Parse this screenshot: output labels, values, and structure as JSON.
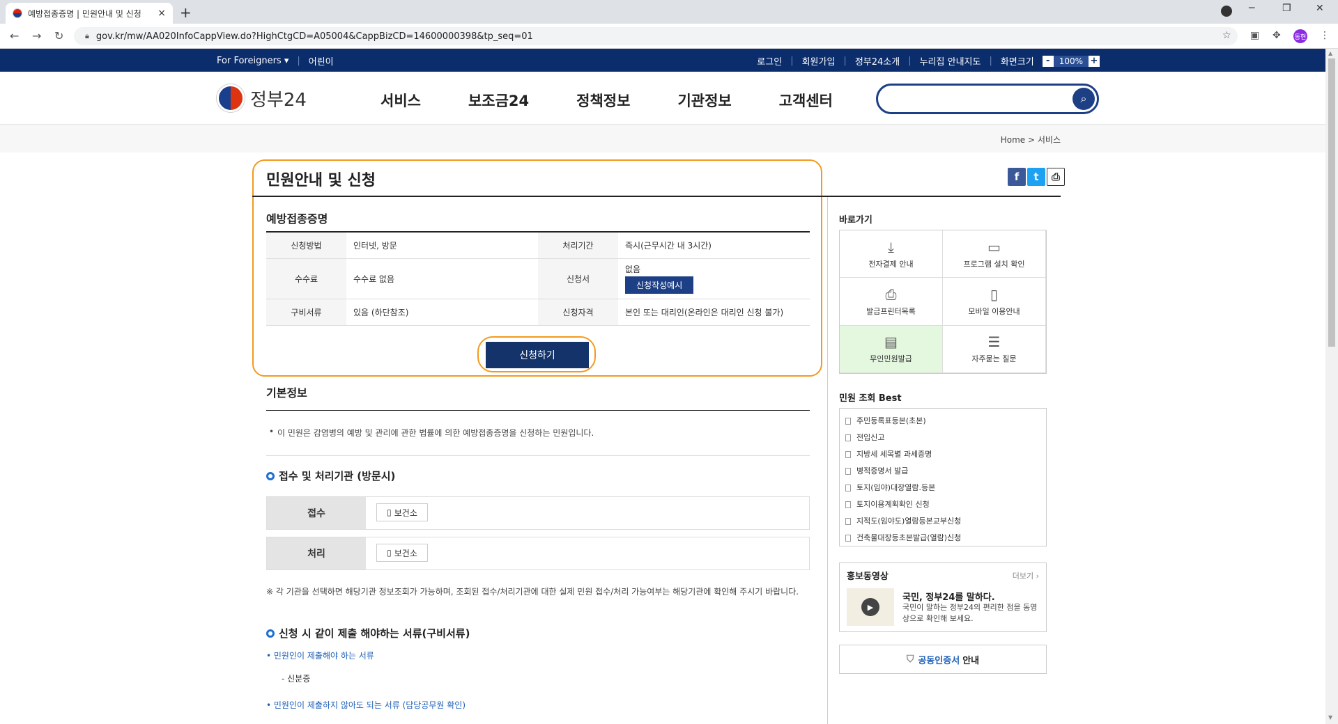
{
  "browser": {
    "tab_title": "예방접종증명 | 민원안내 및 신청",
    "tab_close": "×",
    "new_tab": "+",
    "url": "gov.kr/mw/AA020InfoCappView.do?HighCtgCD=A05004&CappBizCD=14600000398&tp_seq=01",
    "profile_initial": "동현"
  },
  "util": {
    "foreigners": "For Foreigners ▾",
    "kids": "어린이",
    "login": "로그인",
    "signup": "회원가입",
    "intro": "정부24소개",
    "sitemap": "누리집 안내지도",
    "screen_size": "화면크기",
    "zoom_minus": "-",
    "zoom_value": "100%",
    "zoom_plus": "+"
  },
  "header": {
    "logo_text": "정부24",
    "nav": [
      "서비스",
      "보조금24",
      "정책정보",
      "기관정보",
      "고객센터"
    ],
    "search_placeholder": ""
  },
  "breadcrumb": {
    "home": "Home",
    "sep": ">",
    "current": "서비스"
  },
  "page": {
    "title": "민원안내 및 신청",
    "service_name": "예방접종증명",
    "info": {
      "r1": {
        "h1": "신청방법",
        "v1": "인터넷, 방문",
        "h2": "처리기간",
        "v2": "즉시(근무시간 내 3시간)"
      },
      "r2": {
        "h1": "수수료",
        "v1": "수수료 없음",
        "h2": "신청서",
        "v2": "없음",
        "v2_btn": "신청작성예시"
      },
      "r3": {
        "h1": "구비서류",
        "v1": "있음 (하단참조)",
        "h2": "신청자격",
        "v2": "본인 또는 대리인(온라인은 대리인 신청 불가)"
      }
    },
    "apply_button": "신청하기",
    "basic_info_title": "기본정보",
    "basic_info_desc": "이 민원은 감염병의 예방 및 관리에 관한 법률에 의한 예방접종증명을 신청하는 민원입니다.",
    "reception_title": "접수 및 처리기관 (방문시)",
    "reception_label": "접수",
    "process_label": "처리",
    "org_chip": "보건소",
    "note": "※ 각 기관을 선택하면 해당기관 정보조회가 가능하며, 조회된 접수/처리기관에 대한 실제 민원 접수/처리 가능여부는 해당기관에 확인해 주시기 바랍니다.",
    "docs_title": "신청 시 같이 제출 해야하는 서류(구비서류)",
    "docs_required_link": "• 민원인이 제출해야 하는 서류",
    "docs_required_item": "- 신분증",
    "docs_optional_link": "• 민원인이 제출하지 않아도 되는 서류 (담당공무원 확인)"
  },
  "sidebar": {
    "quick_title": "바로가기",
    "quick": [
      "전자결제 안내",
      "프로그램 설치 확인",
      "발급프린터목록",
      "모바일 이용안내",
      "무인민원발급",
      "자주묻는 질문"
    ],
    "best_title": "민원 조회 Best",
    "best": [
      "주민등록표등본(초본)",
      "전입신고",
      "지방세 세목별 과세증명",
      "병적증명서 발급",
      "토지(임야)대장열람.등본",
      "토지이용계획확인 신청",
      "지적도(임야도)열람등본교부신청",
      "건축물대장등초본발급(열람)신청"
    ],
    "promo_title": "홍보동영상",
    "promo_more": "더보기 ›",
    "promo_heading": "국민, 정부24를 말하다.",
    "promo_desc": "국민이 말하는 정부24의 편리한 점을 동영상으로 확인해 보세요.",
    "cert_highlight": "공동인증서",
    "cert_rest": "안내"
  },
  "colors": {
    "navy": "#0b2d6b",
    "button": "#13336a",
    "highlight": "#f39a1e",
    "link": "#1d5fb8"
  }
}
